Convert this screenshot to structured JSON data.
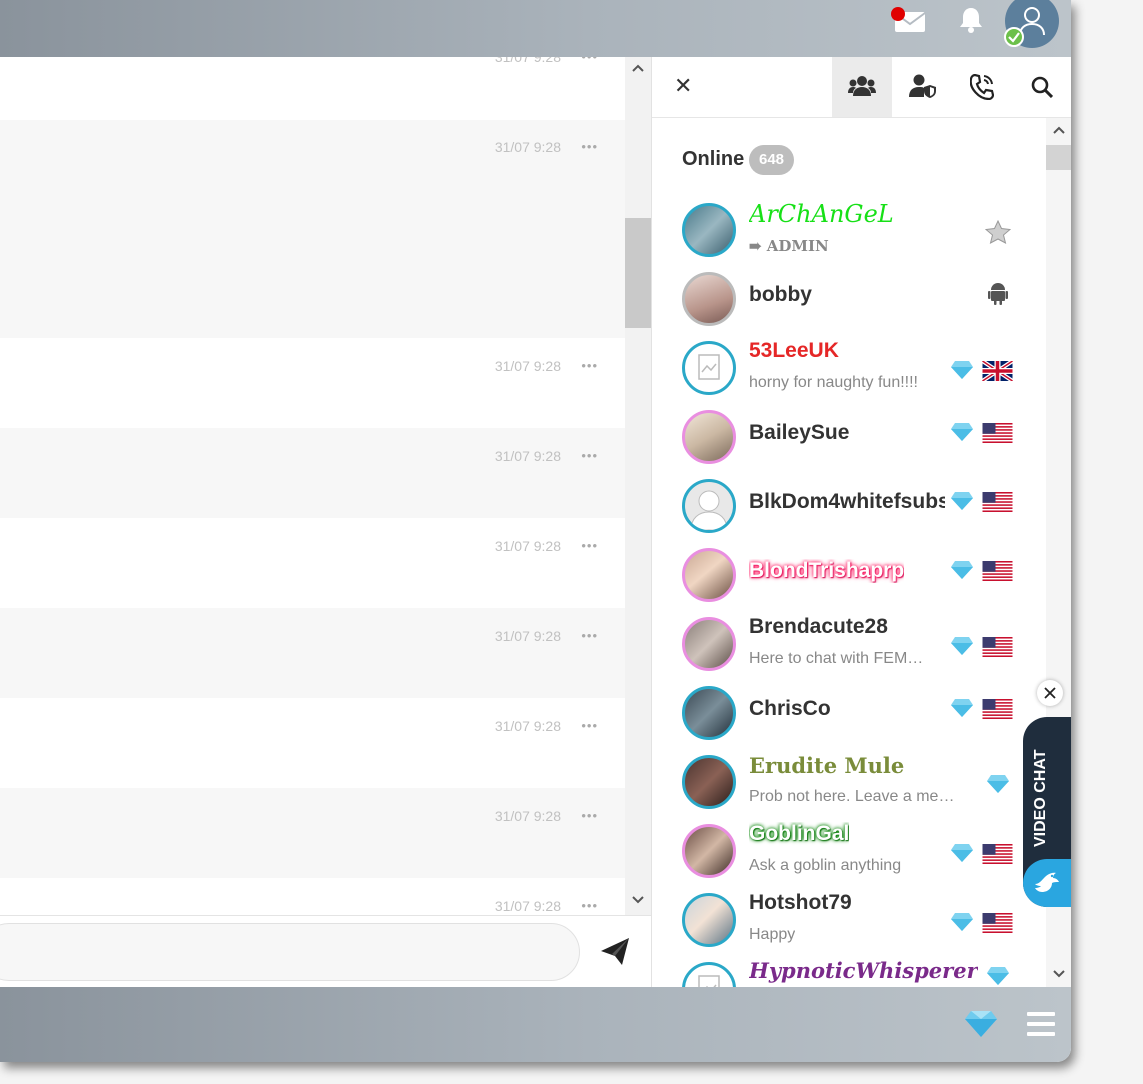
{
  "messages": {
    "timestamps": [
      "31/07 9:28",
      "31/07 9:28",
      "31/07 9:28",
      "31/07 9:28",
      "31/07 9:28",
      "31/07 9:28",
      "31/07 9:28",
      "31/07 9:28",
      "31/07 9:28"
    ],
    "more_label": "•••"
  },
  "panel": {
    "close_label": "✕",
    "online_label": "Online",
    "online_count": "648"
  },
  "users": [
    {
      "name": "ArChAnGeL",
      "sub": "➠ ADMIN",
      "name_color": "#17e017",
      "badge": "star-icon",
      "flag": ""
    },
    {
      "name": "bobby",
      "sub": "",
      "name_color": "#333333",
      "badge": "android-icon",
      "flag": ""
    },
    {
      "name": "53LeeUK",
      "sub": "horny for naughty fun!!!!",
      "name_color": "#e52727",
      "badge": "diamond-icon",
      "flag": "uk-flag"
    },
    {
      "name": "BaileySue",
      "sub": "",
      "name_color": "#333333",
      "badge": "diamond-icon",
      "flag": "us-flag"
    },
    {
      "name": "BlkDom4whitefsubs",
      "sub": "",
      "name_color": "#333333",
      "badge": "diamond-icon",
      "flag": "us-flag"
    },
    {
      "name": "BlondTrishaprp",
      "sub": "",
      "name_color": "#ff4d88",
      "badge": "diamond-icon",
      "flag": "us-flag"
    },
    {
      "name": "Brendacute28",
      "sub": "Here to chat with FEM…",
      "name_color": "#333333",
      "badge": "diamond-icon",
      "flag": "us-flag"
    },
    {
      "name": "ChrisCo",
      "sub": "",
      "name_color": "#333333",
      "badge": "diamond-icon",
      "flag": "us-flag"
    },
    {
      "name": "Erudite Mule",
      "sub": "Prob not here. Leave a me…",
      "name_color": "#7a8c3a",
      "badge": "diamond-icon",
      "flag": ""
    },
    {
      "name": "GoblinGal",
      "sub": "Ask a goblin anything",
      "name_color": "#7be07b",
      "badge": "diamond-icon",
      "flag": "us-flag"
    },
    {
      "name": "Hotshot79",
      "sub": "Happy",
      "name_color": "#333333",
      "badge": "diamond-icon",
      "flag": "us-flag"
    },
    {
      "name": "HypnoticWhisperer",
      "sub": "",
      "name_color": "#7a2a8a",
      "badge": "diamond-icon",
      "flag": ""
    }
  ],
  "video_chat": {
    "label": "VIDEO CHAT"
  },
  "colors": {
    "accent": "#2aa8c8",
    "topbar": "#aab3bb",
    "online_badge": "#bdbdbd"
  }
}
